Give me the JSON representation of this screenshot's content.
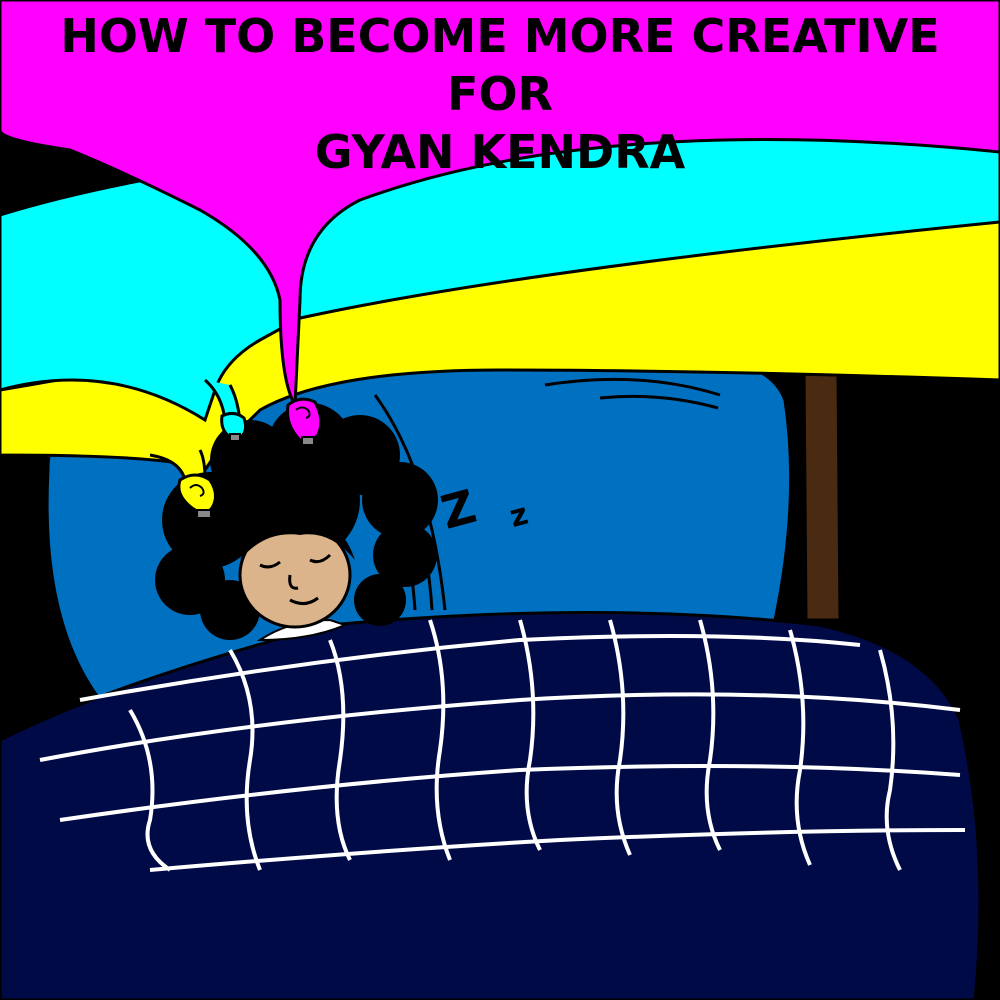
{
  "title": {
    "line1": "HOW TO BECOME MORE CREATIVE",
    "line2": "FOR",
    "line3": "GYAN KENDRA"
  },
  "sleep_text": {
    "big": "Z",
    "small": "z"
  },
  "colors": {
    "magenta": "#ff00ff",
    "cyan": "#00ffff",
    "yellow": "#ffff00",
    "pillow": "#0070c0",
    "blanket": "#000a46",
    "hair": "#000000",
    "skin": "#dcb48c",
    "bedpost": "#4a2a10",
    "background": "#000000"
  },
  "icons": [
    "lightbulb-yellow-icon",
    "lightbulb-cyan-icon",
    "lightbulb-magenta-icon"
  ]
}
